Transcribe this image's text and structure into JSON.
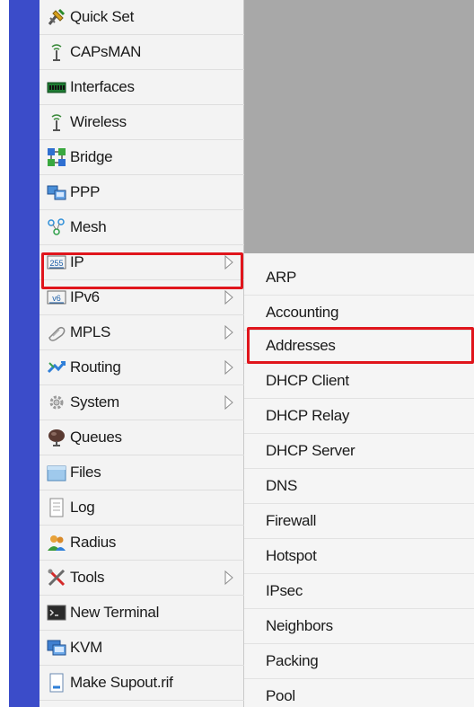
{
  "main_menu": {
    "items": [
      {
        "label": "Quick Set",
        "icon": "quick-set-icon",
        "submenu": false
      },
      {
        "label": "CAPsMAN",
        "icon": "antenna-icon",
        "submenu": false
      },
      {
        "label": "Interfaces",
        "icon": "interfaces-icon",
        "submenu": false
      },
      {
        "label": "Wireless",
        "icon": "antenna-icon",
        "submenu": false
      },
      {
        "label": "Bridge",
        "icon": "bridge-icon",
        "submenu": false
      },
      {
        "label": "PPP",
        "icon": "ppp-icon",
        "submenu": false
      },
      {
        "label": "Mesh",
        "icon": "mesh-icon",
        "submenu": false
      },
      {
        "label": "IP",
        "icon": "ip-icon",
        "submenu": true,
        "icon_text": "255"
      },
      {
        "label": "IPv6",
        "icon": "ipv6-icon",
        "submenu": true,
        "icon_text": "v6"
      },
      {
        "label": "MPLS",
        "icon": "mpls-icon",
        "submenu": true
      },
      {
        "label": "Routing",
        "icon": "routing-icon",
        "submenu": true
      },
      {
        "label": "System",
        "icon": "gear-icon",
        "submenu": true
      },
      {
        "label": "Queues",
        "icon": "queues-icon",
        "submenu": false
      },
      {
        "label": "Files",
        "icon": "folder-icon",
        "submenu": false
      },
      {
        "label": "Log",
        "icon": "log-icon",
        "submenu": false
      },
      {
        "label": "Radius",
        "icon": "users-icon",
        "submenu": false
      },
      {
        "label": "Tools",
        "icon": "tools-icon",
        "submenu": true
      },
      {
        "label": "New Terminal",
        "icon": "terminal-icon",
        "submenu": false
      },
      {
        "label": "KVM",
        "icon": "monitor-icon",
        "submenu": false
      },
      {
        "label": "Make Supout.rif",
        "icon": "document-icon",
        "submenu": false
      }
    ],
    "highlighted": "IP"
  },
  "ip_submenu": {
    "items": [
      "ARP",
      "Accounting",
      "Addresses",
      "DHCP Client",
      "DHCP Relay",
      "DHCP Server",
      "DNS",
      "Firewall",
      "Hotspot",
      "IPsec",
      "Neighbors",
      "Packing",
      "Pool"
    ],
    "highlighted": "Addresses"
  },
  "colors": {
    "side_bar": "#3b4cc9",
    "highlight_border": "#e0151c",
    "background_gray": "#a8a8a8"
  }
}
